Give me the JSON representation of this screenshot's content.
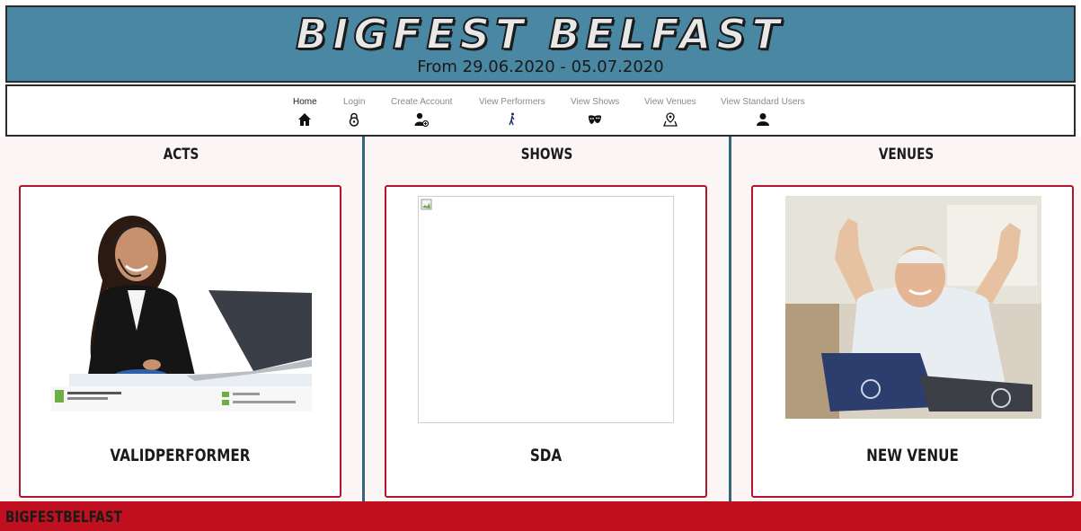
{
  "header": {
    "title": "BIGFEST BELFAST",
    "dates": "From 29.06.2020 - 05.07.2020"
  },
  "nav": {
    "items": [
      {
        "label": "Home",
        "icon": "house-icon"
      },
      {
        "label": "Login",
        "icon": "lock-icon"
      },
      {
        "label": "Create Account",
        "icon": "add-user-icon"
      },
      {
        "label": "View Performers",
        "icon": "performer-icon"
      },
      {
        "label": "View Shows",
        "icon": "theatre-masks-icon"
      },
      {
        "label": "View Venues",
        "icon": "map-marker-icon"
      },
      {
        "label": "View Standard Users",
        "icon": "user-icon"
      }
    ]
  },
  "sections": {
    "acts": {
      "title": "ACTS",
      "card_name": "VALIDPERFORMER"
    },
    "shows": {
      "title": "SHOWS",
      "card_name": "SDA"
    },
    "venues": {
      "title": "VENUES",
      "card_name": "NEW VENUE"
    }
  },
  "footer": {
    "text": "BIGFESTBELFAST"
  },
  "colors": {
    "header_bg": "#4a87a2",
    "accent_red": "#c0101f",
    "separator_blue": "#34657e"
  }
}
